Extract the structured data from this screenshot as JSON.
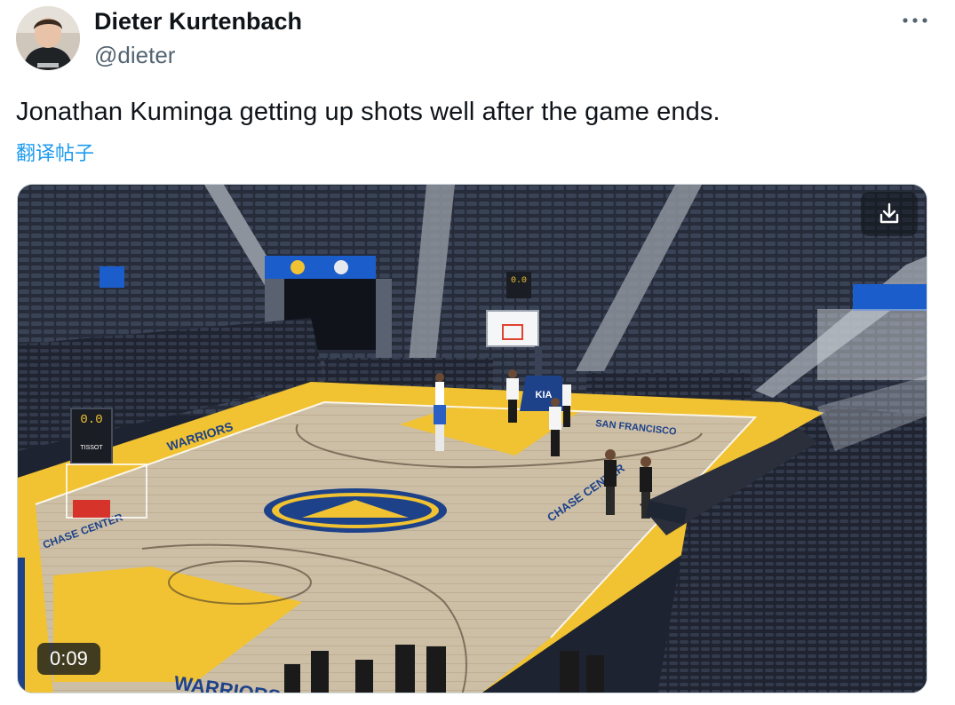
{
  "tweet": {
    "author": {
      "name": "Dieter Kurtenbach",
      "handle": "@dieter",
      "avatar_icon": "avatar-photo"
    },
    "more_icon": "more-horizontal-icon",
    "text": "Jonathan Kuminga getting up shots well after the game ends.",
    "translate_label": "翻译帖子",
    "media": {
      "type": "video",
      "duration": "0:09",
      "download_icon": "download-icon",
      "scoreboard_left": "0.0",
      "scoreboard_right": "0.0",
      "shot_clock_brand": "TISSOT",
      "sponsor_logo": "KIA",
      "baseline_text_left": "CHASE CENTER",
      "baseline_text_right": "SAN FRANCISCO",
      "court_text_bottom": "WARRIORS",
      "sideline_text": "CHASE CENTER",
      "scene_description_colors": {
        "court_yellow": "#f1c232",
        "court_wood": "#cdbca0",
        "seats": "#2a3140",
        "logo_blue": "#1d428a"
      }
    },
    "link_color": "#1d9bf0",
    "text_color": "#0f1419",
    "secondary_color": "#536471"
  }
}
